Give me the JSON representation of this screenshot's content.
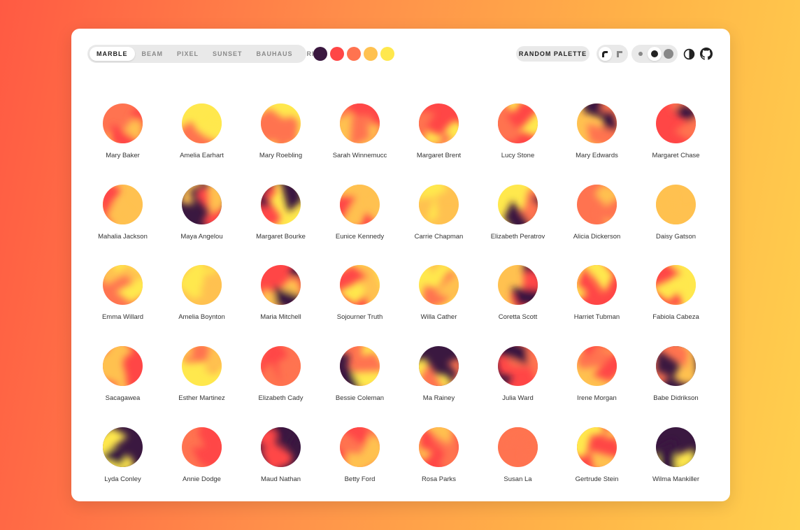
{
  "toolbar": {
    "variants": [
      {
        "label": "MARBLE",
        "active": true
      },
      {
        "label": "BEAM",
        "active": false
      },
      {
        "label": "PIXEL",
        "active": false
      },
      {
        "label": "SUNSET",
        "active": false
      },
      {
        "label": "BAUHAUS",
        "active": false
      },
      {
        "label": "RING",
        "active": false
      }
    ],
    "palette": [
      "#3a1840",
      "#ff4646",
      "#ff7350",
      "#ffc150",
      "#ffe84d"
    ],
    "random_palette_label": "RANDOM PALETTE",
    "shape_options": [
      "round-shape-icon",
      "square-shape-icon"
    ],
    "shape_selected": "round-shape-icon",
    "size_options": [
      "small",
      "medium",
      "large"
    ],
    "size_selected": "medium",
    "icons": [
      "contrast-icon",
      "github-icon"
    ]
  },
  "avatars": [
    {
      "name": "Mary Baker"
    },
    {
      "name": "Amelia Earhart"
    },
    {
      "name": "Mary Roebling"
    },
    {
      "name": "Sarah Winnemucc"
    },
    {
      "name": "Margaret Brent"
    },
    {
      "name": "Lucy Stone"
    },
    {
      "name": "Mary Edwards"
    },
    {
      "name": "Margaret Chase"
    },
    {
      "name": "Mahalia Jackson"
    },
    {
      "name": "Maya Angelou"
    },
    {
      "name": "Margaret Bourke"
    },
    {
      "name": "Eunice Kennedy"
    },
    {
      "name": "Carrie Chapman"
    },
    {
      "name": "Elizabeth Peratrov"
    },
    {
      "name": "Alicia Dickerson"
    },
    {
      "name": "Daisy Gatson"
    },
    {
      "name": "Emma Willard"
    },
    {
      "name": "Amelia Boynton"
    },
    {
      "name": "Maria Mitchell"
    },
    {
      "name": "Sojourner Truth"
    },
    {
      "name": "Willa Cather"
    },
    {
      "name": "Coretta Scott"
    },
    {
      "name": "Harriet Tubman"
    },
    {
      "name": "Fabiola Cabeza"
    },
    {
      "name": "Sacagawea"
    },
    {
      "name": "Esther Martinez"
    },
    {
      "name": "Elizabeth Cady"
    },
    {
      "name": "Bessie Coleman"
    },
    {
      "name": "Ma Rainey"
    },
    {
      "name": "Julia Ward"
    },
    {
      "name": "Irene Morgan"
    },
    {
      "name": "Babe Didrikson"
    },
    {
      "name": "Lyda Conley"
    },
    {
      "name": "Annie Dodge"
    },
    {
      "name": "Maud Nathan"
    },
    {
      "name": "Betty Ford"
    },
    {
      "name": "Rosa Parks"
    },
    {
      "name": "Susan La"
    },
    {
      "name": "Gertrude Stein"
    },
    {
      "name": "Wilma Mankiller"
    }
  ]
}
